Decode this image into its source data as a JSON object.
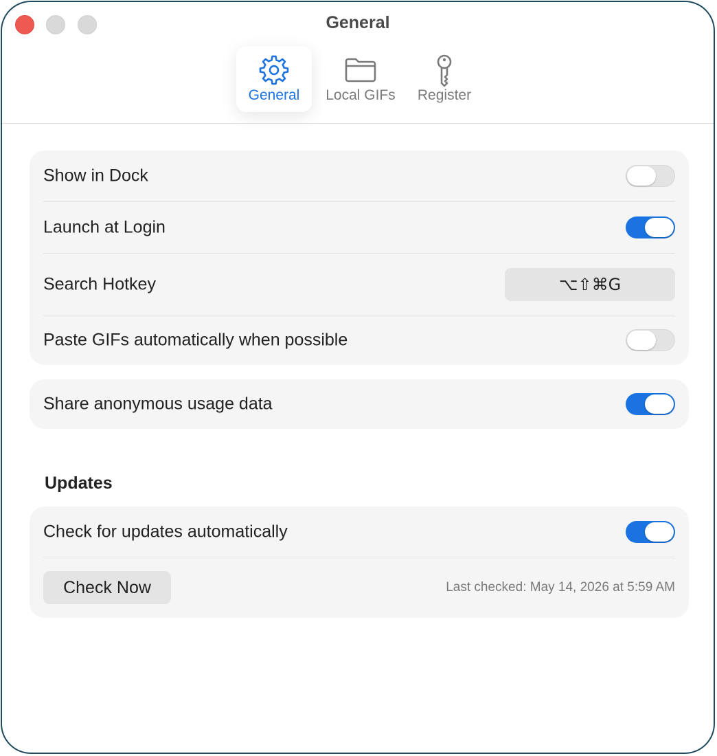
{
  "window": {
    "title": "General"
  },
  "toolbar": {
    "tabs": [
      {
        "label": "General",
        "icon": "gear-icon",
        "active": true
      },
      {
        "label": "Local GIFs",
        "icon": "folder-icon",
        "active": false
      },
      {
        "label": "Register",
        "icon": "key-icon",
        "active": false
      }
    ]
  },
  "settings": {
    "show_in_dock": {
      "label": "Show in Dock",
      "enabled": false
    },
    "launch_at_login": {
      "label": "Launch at Login",
      "enabled": true
    },
    "search_hotkey": {
      "label": "Search Hotkey",
      "value": "⌥⇧⌘G"
    },
    "paste_gifs": {
      "label": "Paste GIFs automatically when possible",
      "enabled": false
    },
    "share_usage": {
      "label": "Share anonymous usage data",
      "enabled": true
    }
  },
  "updates": {
    "heading": "Updates",
    "check_auto": {
      "label": "Check for updates automatically",
      "enabled": true
    },
    "check_now_label": "Check Now",
    "last_checked": "Last checked: May 14, 2026 at 5:59 AM"
  },
  "colors": {
    "accent": "#1a73e0",
    "close": "#ee5a52",
    "group_bg": "#f5f5f5"
  }
}
